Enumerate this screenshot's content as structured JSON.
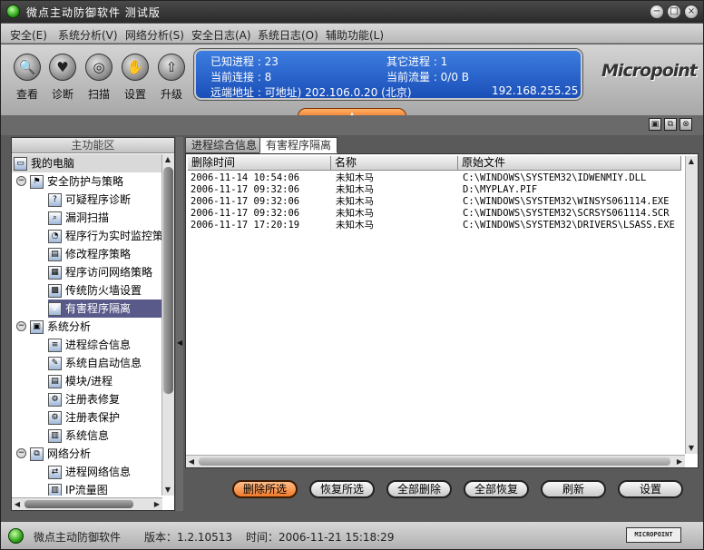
{
  "window": {
    "title": "微点主动防御软件  测试版",
    "controls": [
      "−",
      "□",
      "×"
    ]
  },
  "menu": [
    "安全(E)",
    "系统分析(V)",
    "网络分析(S)",
    "安全日志(A)",
    "系统日志(O)",
    "辅助功能(L)"
  ],
  "toolbar": {
    "tools": [
      {
        "label": "查看",
        "icon": "magnifier-icon",
        "glyph": "🔍"
      },
      {
        "label": "诊断",
        "icon": "heart-icon",
        "glyph": "♥"
      },
      {
        "label": "扫描",
        "icon": "scan-icon",
        "glyph": "◎"
      },
      {
        "label": "设置",
        "icon": "hand-icon",
        "glyph": "✋"
      },
      {
        "label": "升级",
        "icon": "upgrade-icon",
        "glyph": "⇧"
      }
    ],
    "info": {
      "known_procs": "已知进程 : 23",
      "other_procs": "其它进程 : 1",
      "cur_conn": "当前连接 : 8",
      "cur_flow": "当前流量 : 0/0 B",
      "remote": "远端地址 : 可地址)    202.106.0.20 (北京)",
      "local_ip": "192.168.255.25"
    },
    "brand": "Micropoint",
    "expand_glyph": "▲"
  },
  "panel_controls": [
    "▣",
    "⧉",
    "⊗"
  ],
  "left_pane": {
    "header": "主功能区",
    "root": "我的电脑",
    "groups": [
      {
        "label": "安全防护与策略",
        "items": [
          "可疑程序诊断",
          "漏洞扫描",
          "程序行为实时监控策略",
          "修改程序策略",
          "程序访问网络策略",
          "传统防火墙设置",
          "有害程序隔离"
        ]
      },
      {
        "label": "系统分析",
        "items": [
          "进程综合信息",
          "系统自启动信息",
          "模块/进程",
          "注册表修复",
          "注册表保护",
          "系统信息"
        ]
      },
      {
        "label": "网络分析",
        "items": [
          "进程网络信息",
          "IP流量图"
        ]
      }
    ],
    "selected": "有害程序隔离"
  },
  "tabs": [
    "进程综合信息",
    "有害程序隔离"
  ],
  "table": {
    "columns": [
      "删除时间",
      "名称",
      "原始文件"
    ],
    "rows": [
      [
        "2006-11-14 10:54:06",
        "未知木马",
        "C:\\WINDOWS\\SYSTEM32\\IDWENMIY.DLL"
      ],
      [
        "2006-11-17 09:32:06",
        "未知木马",
        "D:\\MYPLAY.PIF"
      ],
      [
        "2006-11-17 09:32:06",
        "未知木马",
        "C:\\WINDOWS\\SYSTEM32\\WINSYS061114.EXE"
      ],
      [
        "2006-11-17 09:32:06",
        "未知木马",
        "C:\\WINDOWS\\SYSTEM32\\SCRSYS061114.SCR"
      ],
      [
        "2006-11-17 17:20:19",
        "未知木马",
        "C:\\WINDOWS\\SYSTEM32\\DRIVERS\\LSASS.EXE"
      ]
    ]
  },
  "buttons": [
    "删除所选",
    "恢复所选",
    "全部删除",
    "全部恢复",
    "刷新",
    "设置"
  ],
  "status": {
    "app": "微点主动防御软件",
    "version": "版本：1.2.10513",
    "time": "时间：2006-11-21 15:18:29",
    "brand_small": "MICROPOINT"
  }
}
